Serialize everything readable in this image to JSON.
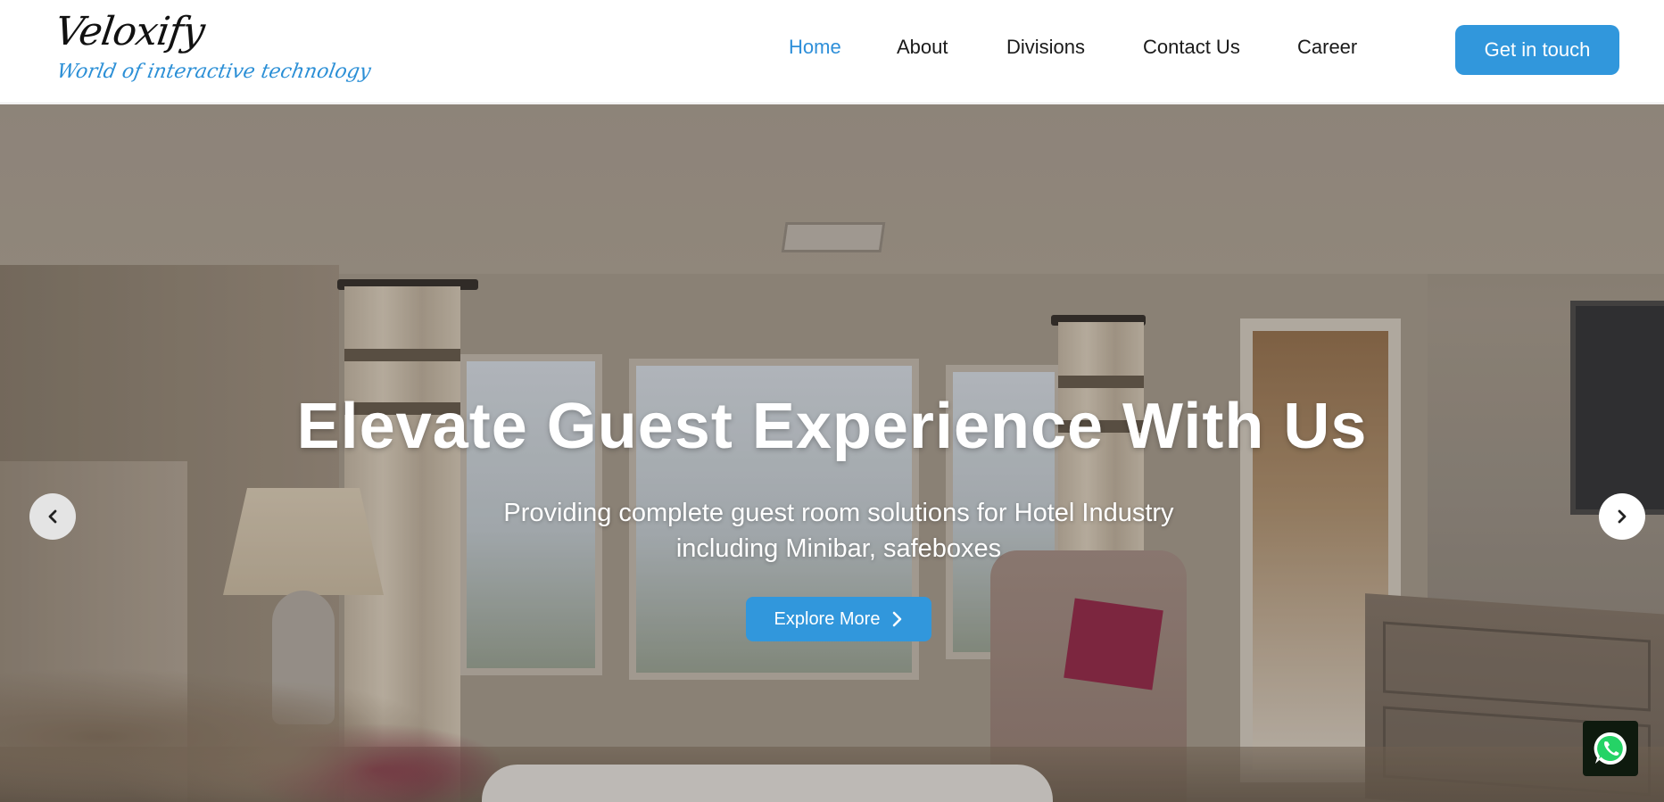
{
  "brand": {
    "name": "Veloxify",
    "tagline": "World of interactive technology"
  },
  "nav": {
    "items": [
      {
        "label": "Home",
        "active": true
      },
      {
        "label": "About",
        "active": false
      },
      {
        "label": "Divisions",
        "active": false
      },
      {
        "label": "Contact Us",
        "active": false
      },
      {
        "label": "Career",
        "active": false
      }
    ],
    "cta_label": "Get in touch"
  },
  "hero": {
    "title": "Elevate Guest Experience With Us",
    "subtitle": "Providing complete guest room solutions for Hotel Industry including Minibar, safeboxes",
    "button_label": "Explore More",
    "prev_icon": "chevron-left-icon",
    "next_icon": "chevron-right-icon"
  },
  "floating": {
    "icon": "whatsapp-icon"
  },
  "colors": {
    "accent": "#3197dc",
    "nav_active": "#2e8fd9",
    "text_dark": "#1a1a1a"
  }
}
